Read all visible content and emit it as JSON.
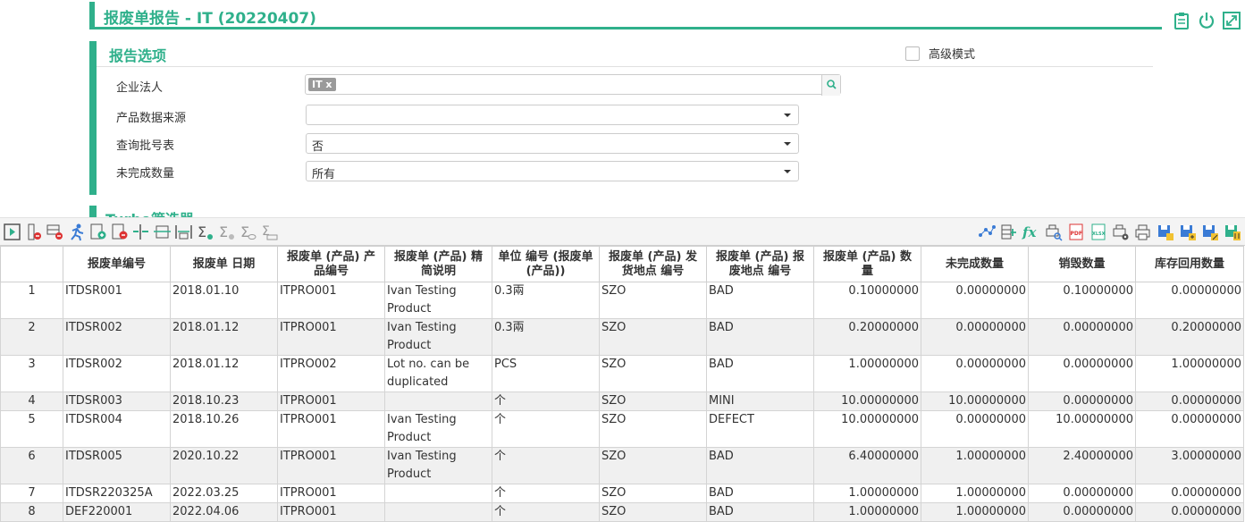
{
  "page": {
    "title": "报废单报告 - IT (20220407)"
  },
  "options": {
    "header": "报告选项",
    "advanced_label": "高级模式",
    "fields": [
      {
        "label": "企业法人",
        "tag": "IT x",
        "value": ""
      },
      {
        "label": "产品数据来源",
        "value": ""
      },
      {
        "label": "查询批号表",
        "value": "否"
      },
      {
        "label": "未完成数量",
        "value": "所有"
      }
    ]
  },
  "turbo": {
    "label": "Turbo筛选器"
  },
  "colors": {
    "accent": "#2fb08b",
    "link": "#2fb08b"
  },
  "toolbar": {
    "left_icons": [
      "play-icon",
      "remove-column-icon",
      "remove-row-icon",
      "runner-icon",
      "add-doc-icon",
      "remove-doc-icon",
      "split-column-icon",
      "fit-column-icon",
      "fit-width-icon",
      "sum-icon",
      "sum-remove-icon",
      "sum-view-icon",
      "sum-scale-icon"
    ],
    "right_icons": [
      "chart-icon",
      "columns-icon",
      "formula-icon",
      "print-preview-icon",
      "pdf-icon",
      "xlsx-icon",
      "print-settings-icon",
      "print-icon",
      "save-layout-icon",
      "save-add-icon",
      "save-edit-icon",
      "save-delete-icon"
    ]
  },
  "table": {
    "headers": [
      "",
      "报废单编号",
      "报废单 日期",
      "报废单 (产品) 产品编号",
      "报废单 (产品) 精简说明",
      "单位 编号 (报废单 (产品))",
      "报废单 (产品) 发货地点 编号",
      "报废单 (产品) 报废地点 编号",
      "报废单 (产品) 数量",
      "未完成数量",
      "销毁数量",
      "库存回用数量"
    ],
    "rows": [
      [
        "1",
        "ITDSR001",
        "2018.01.10",
        "ITPRO001",
        "Ivan Testing Product",
        "0.3兩",
        "SZO",
        "BAD",
        "0.10000000",
        "0.00000000",
        "0.10000000",
        "0.00000000"
      ],
      [
        "2",
        "ITDSR002",
        "2018.01.12",
        "ITPRO001",
        "Ivan Testing Product",
        "0.3兩",
        "SZO",
        "BAD",
        "0.20000000",
        "0.00000000",
        "0.00000000",
        "0.20000000"
      ],
      [
        "3",
        "ITDSR002",
        "2018.01.12",
        "ITPRO002",
        "Lot no. can be duplicated",
        "PCS",
        "SZO",
        "BAD",
        "1.00000000",
        "0.00000000",
        "0.00000000",
        "1.00000000"
      ],
      [
        "4",
        "ITDSR003",
        "2018.10.23",
        "ITPRO001",
        "",
        "个",
        "SZO",
        "MINI",
        "10.00000000",
        "10.00000000",
        "0.00000000",
        "0.00000000"
      ],
      [
        "5",
        "ITDSR004",
        "2018.10.26",
        "ITPRO001",
        "Ivan Testing Product",
        "个",
        "SZO",
        "DEFECT",
        "10.00000000",
        "0.00000000",
        "10.00000000",
        "0.00000000"
      ],
      [
        "6",
        "ITDSR005",
        "2020.10.22",
        "ITPRO001",
        "Ivan Testing Product",
        "个",
        "SZO",
        "BAD",
        "6.40000000",
        "1.00000000",
        "2.40000000",
        "3.00000000"
      ],
      [
        "7",
        "ITDSR220325A",
        "2022.03.25",
        "ITPRO001",
        "",
        "个",
        "SZO",
        "BAD",
        "1.00000000",
        "1.00000000",
        "0.00000000",
        "0.00000000"
      ],
      [
        "8",
        "DEF220001",
        "2022.04.06",
        "ITPRO001",
        "",
        "个",
        "SZO",
        "BAD",
        "1.00000000",
        "1.00000000",
        "0.00000000",
        "0.00000000"
      ]
    ]
  }
}
